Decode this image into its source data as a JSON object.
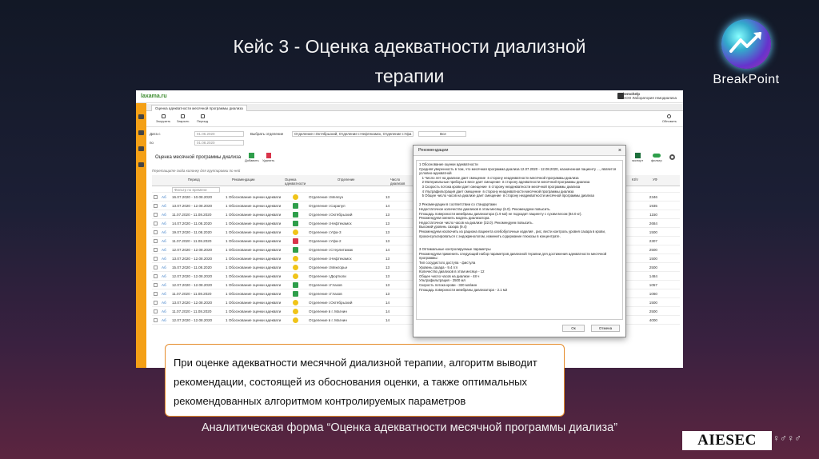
{
  "slide": {
    "title_line1": "Кейс 3 - Оценка адекватности диализной",
    "title_line2": "терапии",
    "brand": "BreakPoint",
    "caption": "При оценке адекватности месячной диализной терапии, алгоритм выводит рекомендации, состоящей из обоснования оценки, а также оптимальных рекомендованных алгоритмом контролируемых параметров",
    "footer": "Аналитическая форма “Оценка адекватности месячной программы диализа”",
    "aiesec": "AIESEC"
  },
  "app": {
    "brand": "laxama.ru",
    "user_name": "hemohelp",
    "user_org": "ООО Лаборатория гемодиализа",
    "tab": "Оценка адекватности месячной программы диализа",
    "toolbar": {
      "load": "Загрузить",
      "close": "Закрыть",
      "period": "Период",
      "refresh": "Обновить"
    },
    "filters": {
      "date_from_label": "Дата с",
      "date_from": "01.06.2020",
      "date_to_label": "по",
      "date_to": "01.08.2020",
      "dept_label": "Выбрать отделение",
      "dept_value": "Отделение г.Октябрьский, Отделение г.Нефтекамск, Отделение г.Уфа",
      "all": "Все"
    },
    "section": {
      "title": "Оценка месячной программы диализа",
      "add": "Добавить",
      "delete": "Удалить",
      "export": "экспорт",
      "filter": "фильтр"
    },
    "hint": "Перетащите сюда колонку для группировки по ней",
    "columns": {
      "period": "Период",
      "rec": "Рекомендации",
      "adequacy": "Оценка адекватности",
      "dept": "Отделение",
      "sessions": "Число диализов",
      "ktv": "Kt/V",
      "uf": "УФ"
    },
    "filter_placeholder": "Фильтр по времени",
    "rows": [
      {
        "p": "16.07.2020 - 10.08.2020",
        "r": "1 Обоснование оценки адеквати",
        "s": "warn",
        "d": "Отделение г.Мелеуз",
        "n": "13",
        "v": "2346"
      },
      {
        "p": "13.07.2020 - 12.08.2020",
        "r": "1 Обоснование оценки адеквати",
        "s": "ok",
        "d": "Отделение г.Сарапул",
        "n": "14",
        "v": "1935"
      },
      {
        "p": "11.07.2020 - 11.08.2020",
        "r": "1 Обоснование оценки адеквати",
        "s": "ok",
        "d": "Отделение г.Октябрьский",
        "n": "13",
        "v": "1150"
      },
      {
        "p": "14.07.2020 - 11.08.2020",
        "r": "1 Обоснование оценки адеквати",
        "s": "ok",
        "d": "Отделение г.Нефтекамск",
        "n": "13",
        "v": "2684"
      },
      {
        "p": "19.07.2020 - 11.08.2020",
        "r": "1 Обоснование оценки адеквати",
        "s": "warn",
        "d": "Отделение г.Уфа-3",
        "n": "13",
        "v": "1500"
      },
      {
        "p": "11.07.2020 - 11.08.2020",
        "r": "1 Обоснование оценки адеквати",
        "s": "bad",
        "d": "Отделение г.Уфа-2",
        "n": "13",
        "v": "2307"
      },
      {
        "p": "12.07.2020 - 12.08.2020",
        "r": "1 Обоснование оценки адеквати",
        "s": "ok",
        "d": "Отделение г.Стерлитамак",
        "n": "14",
        "v": "2500"
      },
      {
        "p": "13.07.2020 - 12.08.2020",
        "r": "1 Обоснование оценки адеквати",
        "s": "warn",
        "d": "Отделение г.Нефтекамск",
        "n": "13",
        "v": "1500"
      },
      {
        "p": "15.07.2020 - 11.08.2020",
        "r": "1 Обоснование оценки адеквати",
        "s": "warn",
        "d": "Отделение г.Межгорье",
        "n": "13",
        "v": "2500"
      },
      {
        "p": "12.07.2020 - 12.08.2020",
        "r": "1 Обоснование оценки адеквати",
        "s": "warn",
        "d": "Отделение г.Дюртюли",
        "n": "13",
        "v": "1484"
      },
      {
        "p": "12.07.2020 - 12.08.2020",
        "r": "1 Обоснование оценки адеквати",
        "s": "ok",
        "d": "Отделение г.Глазов",
        "n": "13",
        "v": "1057"
      },
      {
        "p": "11.07.2020 - 11.08.2020",
        "r": "1 Обоснование оценки адеквати",
        "s": "ok",
        "d": "Отделение г.Глазов",
        "n": "13",
        "v": "1060"
      },
      {
        "p": "13.07.2020 - 12.08.2020",
        "r": "1 Обоснование оценки адеквати",
        "s": "warn",
        "d": "Отделение г.Октябрьский",
        "n": "14",
        "v": "1500"
      },
      {
        "p": "11.07.2020 - 11.08.2020",
        "r": "1 Обоснование оценки адеквати",
        "s": "warn",
        "d": "Отделение в г. Магнин",
        "n": "14",
        "v": "2500"
      },
      {
        "p": "12.07.2020 - 12.08.2020",
        "r": "1 Обоснование оценки адеквати",
        "s": "warn",
        "d": "Отделение в г. Магнин",
        "n": "14",
        "v": "4000"
      }
    ],
    "dialog": {
      "title": "Рекомендации",
      "ok": "Ок",
      "cancel": "Отмена",
      "body": "1 Обоснование оценки адекватности\nСредняя уверенность в том, что месячная программа диализа 12.07.2020 - 12.08.2020, назначенная пациенту ..., является условно-адекватной\n   1 Число лет на диализе дает смещение  в сторону неадекватности месячной программы диализа\n   2 Материальные приборы в весе дает смещение  в сторону адекватности месячной программы диализа\n   3 Скорость потока крови дает смещение  в сторону неадекватности месячной программы диализа\n   4 Ультрафильтрация дает смещение  в сторону неадекватности месячной программы диализа\n   5 Общее число часов на диализе дает смещение  в сторону неадекватности месячной программы диализа\n\n2 Рекомендации в соответствии со стандартами\nНедостаточное количество диализов в этом месяце (6.0). Рекомендуем повысить.\nПлощадь поверхности мембраны диализатора (1.9 м2) не подходит пациенту с сухим весом (84.0 кг).\nРекомендуем сменить модель диализатора.\nНедостаточное число часов на диализе (32.0). Рекомендуем повысить.\nВысокий уровень сахара (9.4)\nРекомендуем исключить из рациона пациента хлебобулочные изделия , рис, вести контроль уровня сахара в крови, проконсультироваться с эндокринологом, изменить содержание глюкозы в концентрате.\n\n\n3 Оптимальные контролируемые параметры\nРекомендуем применить следующий набор параметров диализной терапии для достижения адекватности месячной программы:\nТип сосудистого доступа - фистула\nУровень сахара - 9.4 ггл\nКоличество диализов в этом месяце - 12\nОбщее число часов на диализе - 48 ч\nУльтрафильтрация - 2500 мл\nСкорость потока крови - 320 мл/мин\nПлощадь поверхности мембраны диализатора - 2.1 м2"
    }
  }
}
